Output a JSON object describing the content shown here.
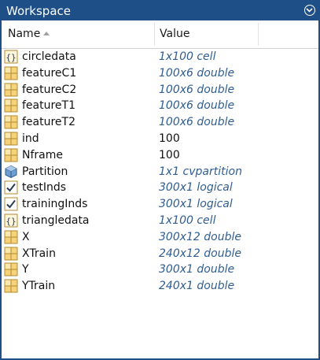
{
  "panel": {
    "title": "Workspace",
    "menu_icon": "chevron-down-circle-icon"
  },
  "columns": {
    "name": "Name",
    "value": "Value",
    "sort_icon": "sort-ascending-icon"
  },
  "variables": [
    {
      "name": "circledata",
      "value": "1x100 cell",
      "icon": "cell-icon",
      "italic": true
    },
    {
      "name": "featureC1",
      "value": "100x6 double",
      "icon": "matrix-icon",
      "italic": true
    },
    {
      "name": "featureC2",
      "value": "100x6 double",
      "icon": "matrix-icon",
      "italic": true
    },
    {
      "name": "featureT1",
      "value": "100x6 double",
      "icon": "matrix-icon",
      "italic": true
    },
    {
      "name": "featureT2",
      "value": "100x6 double",
      "icon": "matrix-icon",
      "italic": true
    },
    {
      "name": "ind",
      "value": "100",
      "icon": "matrix-icon",
      "italic": false
    },
    {
      "name": "Nframe",
      "value": "100",
      "icon": "matrix-icon",
      "italic": false
    },
    {
      "name": "Partition",
      "value": "1x1 cvpartition",
      "icon": "object-icon",
      "italic": true
    },
    {
      "name": "testInds",
      "value": "300x1 logical",
      "icon": "logical-icon",
      "italic": true
    },
    {
      "name": "trainingInds",
      "value": "300x1 logical",
      "icon": "logical-icon",
      "italic": true
    },
    {
      "name": "triangledata",
      "value": "1x100 cell",
      "icon": "cell-icon",
      "italic": true
    },
    {
      "name": "X",
      "value": "300x12 double",
      "icon": "matrix-icon",
      "italic": true
    },
    {
      "name": "XTrain",
      "value": "240x12 double",
      "icon": "matrix-icon",
      "italic": true
    },
    {
      "name": "Y",
      "value": "300x1 double",
      "icon": "matrix-icon",
      "italic": true
    },
    {
      "name": "YTrain",
      "value": "240x1 double",
      "icon": "matrix-icon",
      "italic": true
    }
  ],
  "colors": {
    "titlebar": "#1e4f86",
    "value_text": "#2f5d92"
  }
}
